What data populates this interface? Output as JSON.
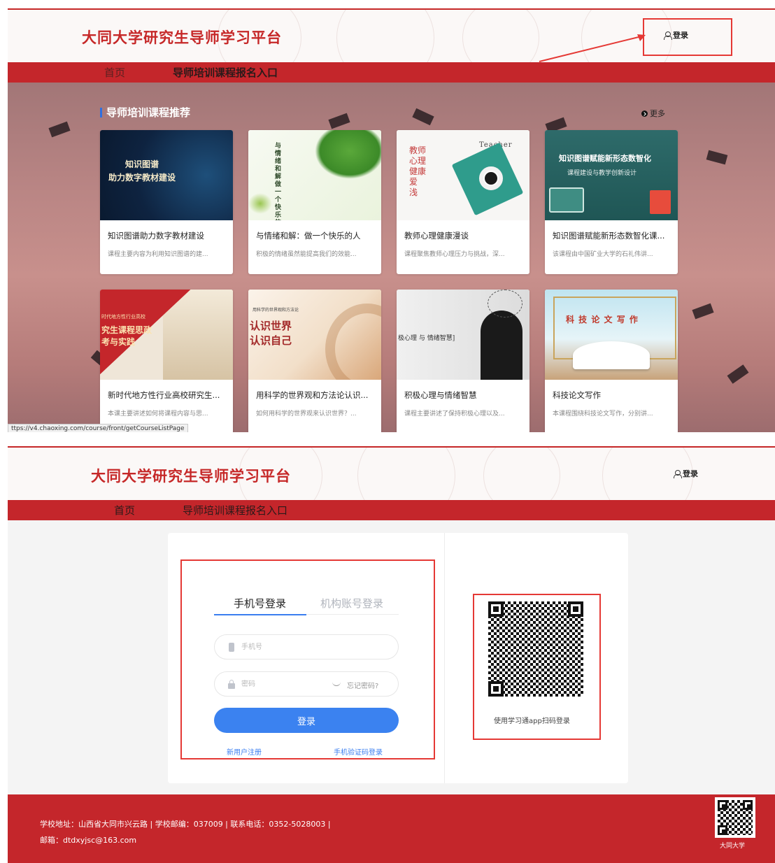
{
  "site": {
    "title": "大同大学研究生导师学习平台",
    "login_label": "登录"
  },
  "nav": [
    {
      "label": "首页"
    },
    {
      "label": "导师培训课程报名入口"
    }
  ],
  "courses_section": {
    "title": "导师培训课程推荐",
    "more_label": "更多",
    "status_url": "ttps://v4.chaoxing.com/course/front/getCourseListPage",
    "items": [
      {
        "title": "知识图谱助力数字教材建设",
        "desc": "课程主要内容为利用知识图谱的建...",
        "thumb_text": "知识图谱\n助力数字教材建设"
      },
      {
        "title": "与情绪和解：做一个快乐的人",
        "desc": "积极的情绪虽然能提高我们的效能...",
        "thumb_text": "与情绪和解 做一个快乐的人"
      },
      {
        "title": "教师心理健康漫谈",
        "desc": "课程聚焦教师心理压力与挑战，深...",
        "thumb_text": "教师 心理健康 爱 浅",
        "thumb_en": "Teacher"
      },
      {
        "title": "知识图谱赋能新形态数智化课...",
        "desc": "该课程由中国矿业大学的石礼伟讲...",
        "thumb_text": "知识图谱赋能新形态数智化",
        "thumb_sub": "课程建设与教学创新设计"
      },
      {
        "title": "新时代地方性行业高校研究生...",
        "desc": "本课主要讲述如何将课程内容与思...",
        "thumb_text": "究生课程思政\n考与实践",
        "thumb_small": "时代地方性行业高校"
      },
      {
        "title": "用科学的世界观和方法论认识...",
        "desc": "如何用科学的世界观来认识世界？...",
        "thumb_text": "认识世界\n认识自己",
        "thumb_small": "用科学的世界观和方法论"
      },
      {
        "title": "积极心理与情绪智慧",
        "desc": "课程主要讲述了保持积极心理以及...",
        "thumb_text": "极心理 与 情绪智慧]"
      },
      {
        "title": "科技论文写作",
        "desc": "本课程围绕科技论文写作，分别讲...",
        "thumb_text": "科 技 论 文 写 作"
      }
    ]
  },
  "login": {
    "tabs": [
      {
        "label": "手机号登录"
      },
      {
        "label": "机构账号登录"
      }
    ],
    "phone_placeholder": "手机号",
    "password_placeholder": "密码",
    "forgot_label": "忘记密码?",
    "submit_label": "登录",
    "register_label": "新用户注册",
    "sms_login_label": "手机验证码登录",
    "qr_caption": "使用学习通app扫码登录"
  },
  "footer": {
    "line1": "学校地址：山西省大同市兴云路 | 学校邮编：037009 | 联系电话：0352-5028003 |",
    "line2": "邮箱：dtdxyjsc@163.com",
    "qr_caption": "大同大学"
  },
  "colors": {
    "brand_red": "#c4262b",
    "title_red": "#c62828",
    "accent_blue": "#3b82f0",
    "annotation_red": "#e53935"
  }
}
